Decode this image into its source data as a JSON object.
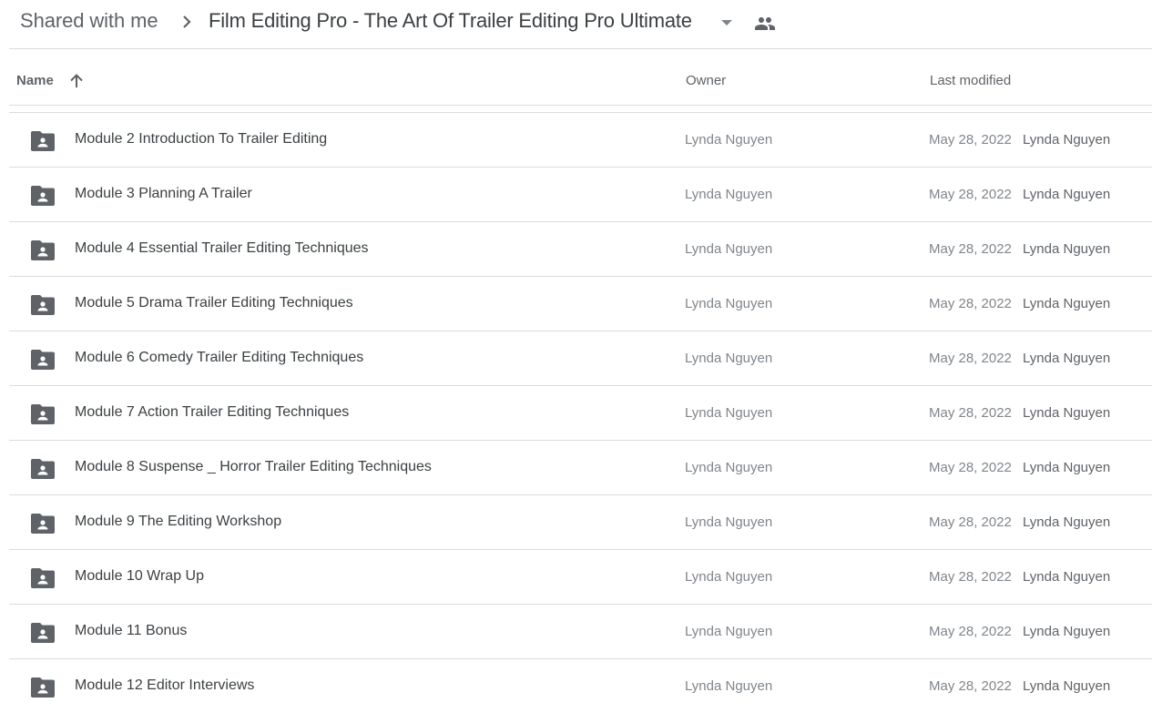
{
  "breadcrumb": {
    "root": "Shared with me",
    "current": "Film Editing Pro - The Art Of Trailer Editing Pro Ultimate",
    "icons": {
      "separator": "chevron-right-icon",
      "dropdown": "caret-down-icon",
      "shared": "people-icon"
    }
  },
  "columns": {
    "name": "Name",
    "owner": "Owner",
    "last_modified": "Last modified",
    "sort": {
      "column": "Name",
      "direction": "ascending",
      "icon": "arrow-up-icon"
    }
  },
  "colors": {
    "icon": "#5f6368",
    "divider": "#dadce0",
    "text": "#3c4043",
    "muted": "#80868b"
  },
  "rows": [
    {
      "name": "Module 2 Introduction To Trailer Editing",
      "owner": "Lynda Nguyen",
      "date": "May 28, 2022",
      "modified_by": "Lynda Nguyen",
      "icon": "shared-folder-icon"
    },
    {
      "name": "Module 3 Planning A Trailer",
      "owner": "Lynda Nguyen",
      "date": "May 28, 2022",
      "modified_by": "Lynda Nguyen",
      "icon": "shared-folder-icon"
    },
    {
      "name": "Module 4 Essential Trailer Editing Techniques",
      "owner": "Lynda Nguyen",
      "date": "May 28, 2022",
      "modified_by": "Lynda Nguyen",
      "icon": "shared-folder-icon"
    },
    {
      "name": "Module 5 Drama Trailer Editing Techniques",
      "owner": "Lynda Nguyen",
      "date": "May 28, 2022",
      "modified_by": "Lynda Nguyen",
      "icon": "shared-folder-icon"
    },
    {
      "name": "Module 6 Comedy Trailer Editing Techniques",
      "owner": "Lynda Nguyen",
      "date": "May 28, 2022",
      "modified_by": "Lynda Nguyen",
      "icon": "shared-folder-icon"
    },
    {
      "name": "Module 7 Action Trailer Editing Techniques",
      "owner": "Lynda Nguyen",
      "date": "May 28, 2022",
      "modified_by": "Lynda Nguyen",
      "icon": "shared-folder-icon"
    },
    {
      "name": "Module 8 Suspense _ Horror Trailer Editing Techniques",
      "owner": "Lynda Nguyen",
      "date": "May 28, 2022",
      "modified_by": "Lynda Nguyen",
      "icon": "shared-folder-icon"
    },
    {
      "name": "Module 9 The Editing Workshop",
      "owner": "Lynda Nguyen",
      "date": "May 28, 2022",
      "modified_by": "Lynda Nguyen",
      "icon": "shared-folder-icon"
    },
    {
      "name": "Module 10 Wrap Up",
      "owner": "Lynda Nguyen",
      "date": "May 28, 2022",
      "modified_by": "Lynda Nguyen",
      "icon": "shared-folder-icon"
    },
    {
      "name": "Module 11 Bonus",
      "owner": "Lynda Nguyen",
      "date": "May 28, 2022",
      "modified_by": "Lynda Nguyen",
      "icon": "shared-folder-icon"
    },
    {
      "name": "Module 12 Editor Interviews",
      "owner": "Lynda Nguyen",
      "date": "May 28, 2022",
      "modified_by": "Lynda Nguyen",
      "icon": "shared-folder-icon"
    }
  ]
}
